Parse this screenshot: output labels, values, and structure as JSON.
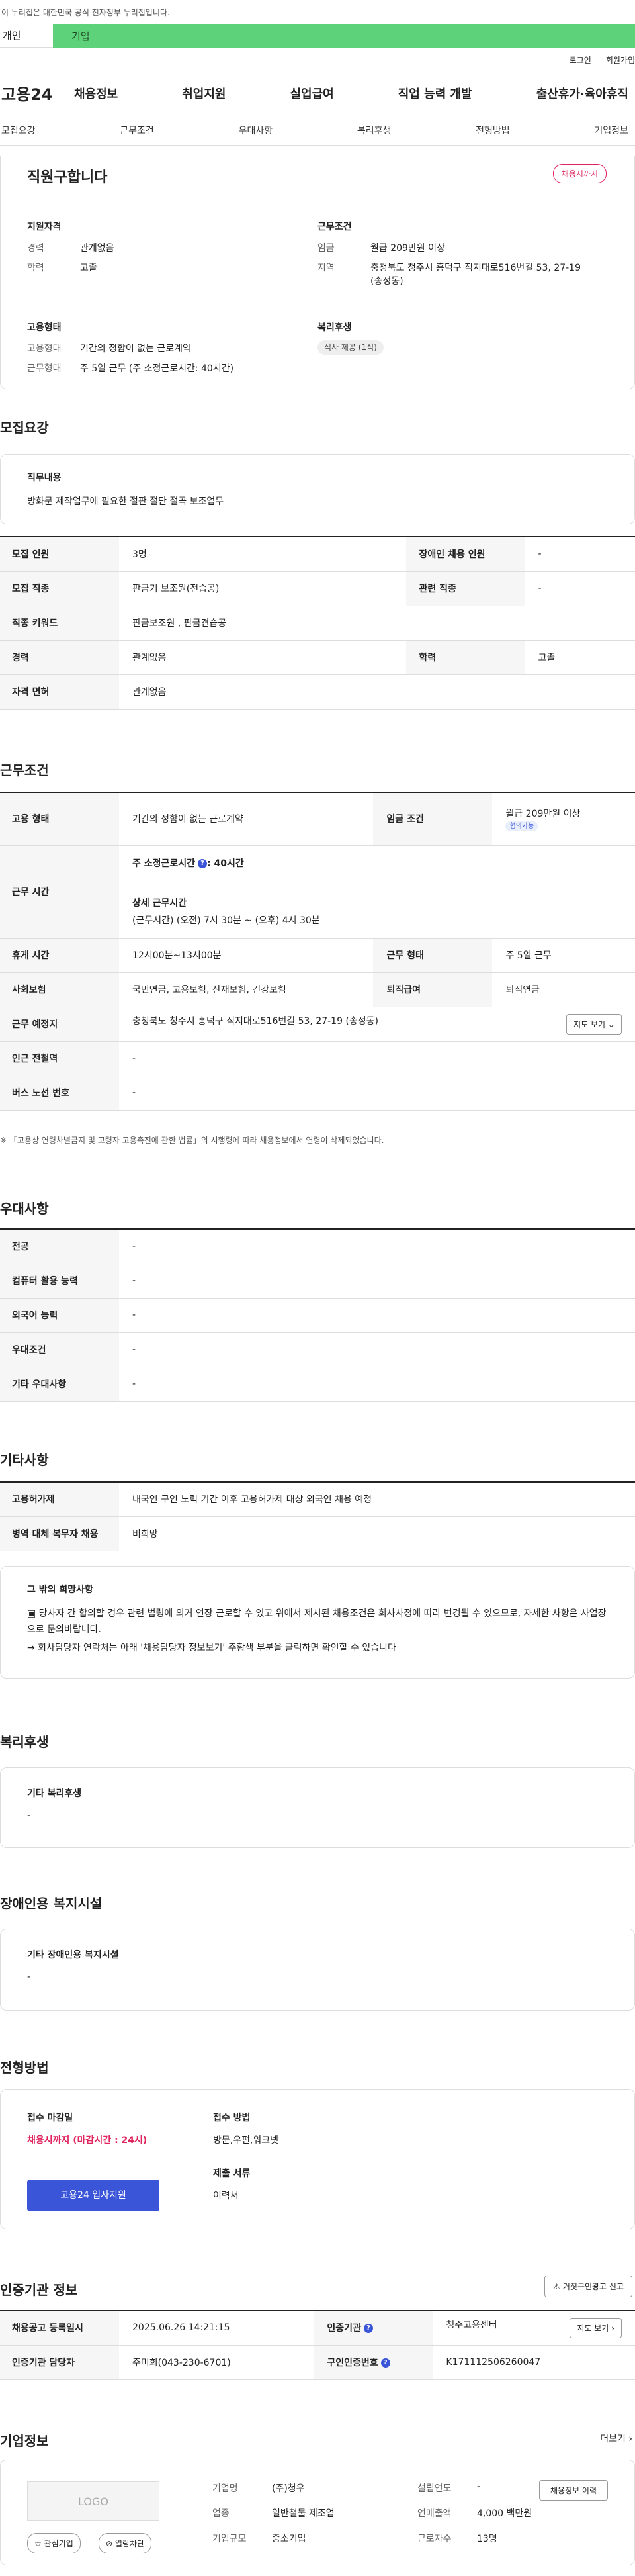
{
  "top_notice": "이 누리집은 대한민국 공식 전자정부 누리집입니다.",
  "user_tabs": {
    "individual": "개인",
    "business": "기업"
  },
  "util": {
    "login": "로그인",
    "join": "회원가입"
  },
  "logo": "고용24",
  "gnb": [
    "채용정보",
    "취업지원",
    "실업급여",
    "직업 능력 개발",
    "출산휴가·육아휴직"
  ],
  "subnav": [
    "모집요강",
    "근무조건",
    "우대사항",
    "복리후생",
    "전형방법",
    "기업정보"
  ],
  "summary": {
    "title": "직원구합니다",
    "status_badge": "채용시까지",
    "qualification": {
      "head": "지원자격",
      "career_k": "경력",
      "career_v": "관계없음",
      "edu_k": "학력",
      "edu_v": "고졸"
    },
    "condition": {
      "head": "근무조건",
      "wage_k": "임금",
      "wage_v": "월급 209만원 이상",
      "region_k": "지역",
      "region_v": "충청북도 청주시 흥덕구 직지대로516번길 53, 27-19 (송정동)"
    },
    "employment": {
      "head": "고용형태",
      "type_k": "고용형태",
      "type_v": "기간의 정함이 없는 근로계약",
      "shape_k": "근무형태",
      "shape_v": "주 5일 근무 (주 소정근로시간: 40시간)"
    },
    "welfare": {
      "head": "복리후생",
      "chip": "식사 제공 (1식)"
    }
  },
  "recruit": {
    "title": "모집요강",
    "job_head": "직무내용",
    "job_desc": "방화문 제작업무에 필요한 절판 절단 절곡 보조업무",
    "rows": {
      "count_k": "모집 인원",
      "count_v": "3명",
      "disabled_k": "장애인 채용 인원",
      "disabled_v": "-",
      "job_k": "모집 직종",
      "job_v": "판금기 보조원(전습공)",
      "related_k": "관련 직종",
      "related_v": "-",
      "kw_k": "직종 키워드",
      "kw_v": "판금보조원 , 판금견습공",
      "career_k": "경력",
      "career_v": "관계없음",
      "edu_k": "학력",
      "edu_v": "고졸",
      "license_k": "자격 면허",
      "license_v": "관계없음"
    }
  },
  "work": {
    "title": "근무조건",
    "type_k": "고용 형태",
    "type_v": "기간의 정함이 없는 근로계약",
    "wage_k": "임금 조건",
    "wage_v": "월급 209만원 이상",
    "wage_chip": "협의가능",
    "time_k": "근무 시간",
    "time_weekly_label": "주 소정근로시간",
    "time_weekly_v": ": 40시간",
    "time_detail_head": "상세 근무시간",
    "time_detail_v": "(근무시간) (오전) 7시 30분 ~ (오후) 4시 30분",
    "break_k": "휴게 시간",
    "break_v": "12시00분~13시00분",
    "shape_k": "근무 형태",
    "shape_v": "주 5일 근무",
    "ins_k": "사회보험",
    "ins_v": "국민연금, 고용보험, 산재보험, 건강보험",
    "ret_k": "퇴직급여",
    "ret_v": "퇴직연금",
    "place_k": "근무 예정지",
    "place_v": "충청북도 청주시 흥덕구 직지대로516번길 53, 27-19 (송정동)",
    "map_btn": "지도 보기",
    "subway_k": "인근 전철역",
    "subway_v": "-",
    "bus_k": "버스 노선 번호",
    "bus_v": "-",
    "note": "※ 「고용상 연령차별금지 및 고령자 고용촉진에 관한 법률」의 시행령에 따라 채용정보에서 연령이 삭제되었습니다."
  },
  "pref": {
    "title": "우대사항",
    "major_k": "전공",
    "major_v": "-",
    "pc_k": "컴퓨터 활용 능력",
    "pc_v": "-",
    "lang_k": "외국어 능력",
    "lang_v": "-",
    "cond_k": "우대조건",
    "cond_v": "-",
    "etc_k": "기타 우대사항",
    "etc_v": "-"
  },
  "etc": {
    "title": "기타사항",
    "foreign_k": "고용허가제",
    "foreign_v": "내국인 구인 노력 기간 이후 고용허가제 대상 외국인 채용 예정",
    "military_k": "병역 대체 복무자 채용",
    "military_v": "비희망",
    "other_head": "그 밖의 희망사항",
    "other_line1": "▣ 당사자 간 합의할 경우 관련 법령에 의거 연장 근로할 수 있고 위에서 제시된 채용조건은 회사사정에 따라 변경될 수 있으므로, 자세한 사항은 사업장으로 문의바랍니다.",
    "other_line2": "→ 회사담당자 연락처는 아래 '채용담당자 정보보기' 주황색 부분을 클릭하면 확인할 수 있습니다"
  },
  "welfare": {
    "title": "복리후생",
    "head": "기타 복리후생",
    "value": "-"
  },
  "facility": {
    "title": "장애인용 복지시설",
    "head": "기타 장애인용 복지시설",
    "value": "-"
  },
  "select": {
    "title": "전형방법",
    "deadline_head": "접수 마감일",
    "deadline_v": "채용시까지 (마감시간 : 24시)",
    "apply_btn": "고용24 입사지원",
    "method_head": "접수 방법",
    "method_v": "방문,우편,워크넷",
    "docs_head": "제출 서류",
    "docs_v": "이력서"
  },
  "cert": {
    "title": "인증기관 정보",
    "report_btn": "거짓구인광고 신고",
    "reg_k": "채용공고 등록일시",
    "reg_v": "2025.06.26 14:21:15",
    "org_k": "인증기관",
    "org_v": "청주고용센터",
    "map_btn": "지도 보기",
    "mgr_k": "인증기관 담당자",
    "mgr_v": "주미희(043-230-6701)",
    "no_k": "구인인증번호",
    "no_v": "K171112506260047"
  },
  "company": {
    "title": "기업정보",
    "more": "더보기",
    "logo_text": "LOGO",
    "fav_btn": "관심기업",
    "block_btn": "열람차단",
    "name_k": "기업명",
    "name_v": "(주)청우",
    "founded_k": "설립연도",
    "founded_v": "-",
    "history_btn": "채용정보 이력",
    "industry_k": "업종",
    "industry_v": "일반철물 제조업",
    "sales_k": "연매출액",
    "sales_v": "4,000 백만원",
    "size_k": "기업규모",
    "size_v": "중소기업",
    "emp_k": "근로자수",
    "emp_v": "13명"
  }
}
